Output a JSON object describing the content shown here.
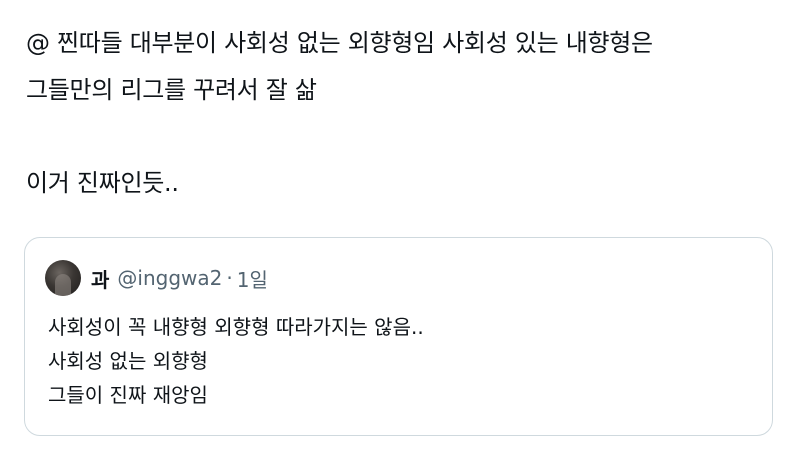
{
  "tweet": {
    "lines": [
      "@ 찐따들 대부분이 사회성 없는 외향형임 사회성 있는 내향형은",
      "그들만의 리그를 꾸려서 잘 삶",
      "이거 진짜인듯.."
    ]
  },
  "quote": {
    "display_name": "과",
    "handle": "@inggwa2",
    "separator": "·",
    "time": "1일",
    "lines": [
      "사회성이 꼭 내향형 외향형 따라가지는 않음..",
      "사회성 없는 외향형",
      "그들이 진짜 재앙임"
    ]
  }
}
